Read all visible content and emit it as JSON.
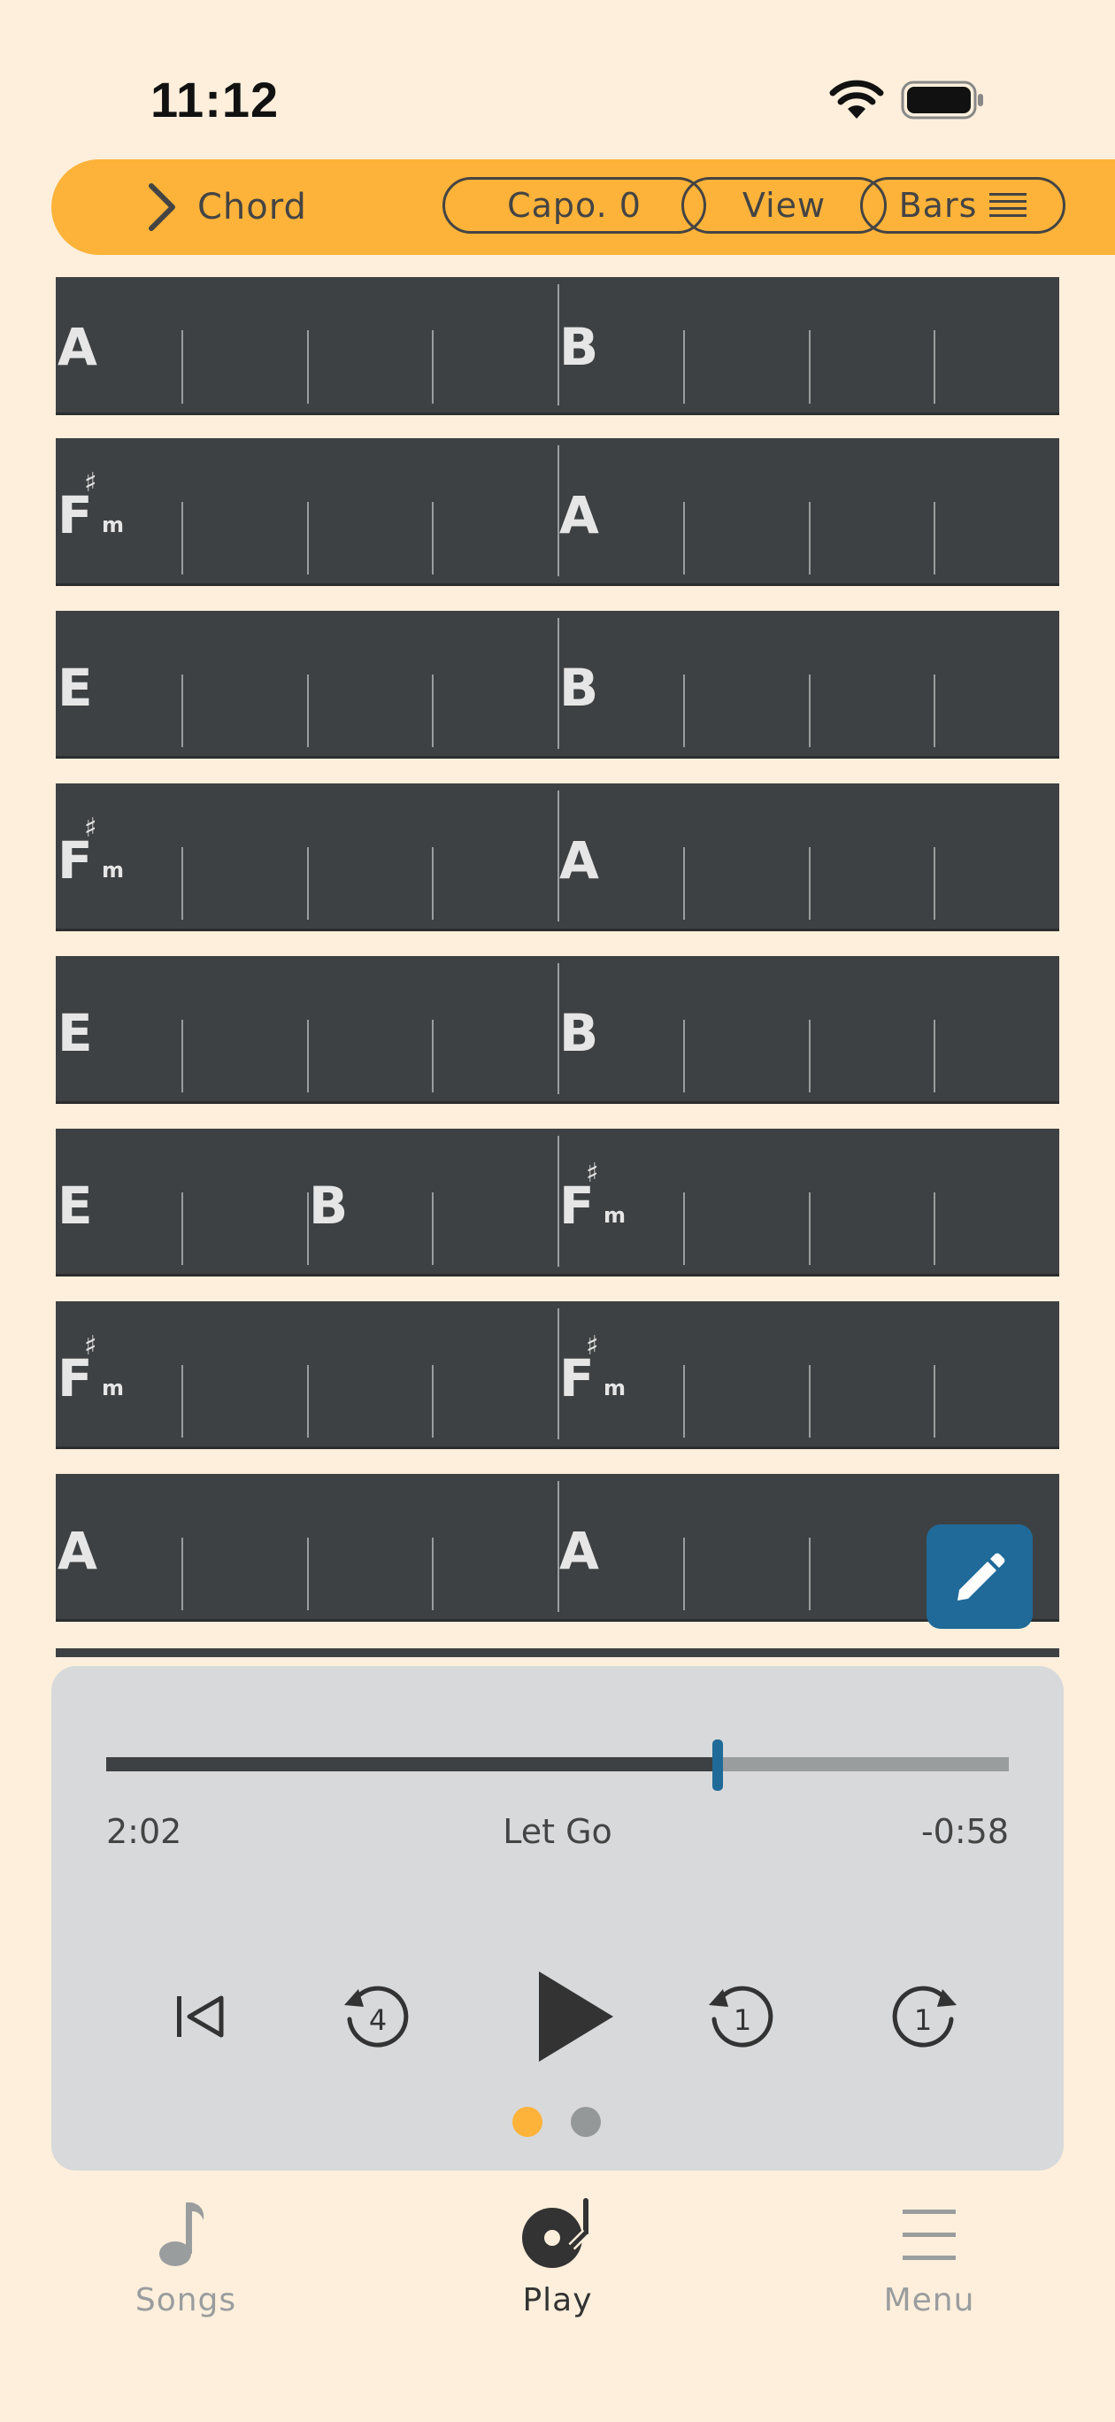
{
  "status_bar": {
    "time": "11:12",
    "wifi_icon": "wifi-icon",
    "battery_icon": "battery-icon"
  },
  "header": {
    "back_icon": "chevron-right-icon",
    "title": "Chord",
    "capo_label": "Capo. 0",
    "view_label": "View",
    "bars_label": "Bars",
    "bars_icon": "list-lines-icon",
    "accent_color": "#fdb339"
  },
  "chord_rows": [
    {
      "chords": [
        {
          "root": "A",
          "acc": "",
          "qual": "",
          "beat": 0
        },
        {
          "root": "B",
          "acc": "",
          "qual": "",
          "beat": 4
        }
      ]
    },
    {
      "chords": [
        {
          "root": "F",
          "acc": "♯",
          "qual": "m",
          "beat": 0
        },
        {
          "root": "A",
          "acc": "",
          "qual": "",
          "beat": 4
        }
      ]
    },
    {
      "chords": [
        {
          "root": "E",
          "acc": "",
          "qual": "",
          "beat": 0
        },
        {
          "root": "B",
          "acc": "",
          "qual": "",
          "beat": 4
        }
      ]
    },
    {
      "chords": [
        {
          "root": "F",
          "acc": "♯",
          "qual": "m",
          "beat": 0
        },
        {
          "root": "A",
          "acc": "",
          "qual": "",
          "beat": 4
        }
      ]
    },
    {
      "chords": [
        {
          "root": "E",
          "acc": "",
          "qual": "",
          "beat": 0
        },
        {
          "root": "B",
          "acc": "",
          "qual": "",
          "beat": 4
        }
      ]
    },
    {
      "chords": [
        {
          "root": "E",
          "acc": "",
          "qual": "",
          "beat": 0
        },
        {
          "root": "B",
          "acc": "",
          "qual": "",
          "beat": 2
        },
        {
          "root": "F",
          "acc": "♯",
          "qual": "m",
          "beat": 4
        }
      ]
    },
    {
      "chords": [
        {
          "root": "F",
          "acc": "♯",
          "qual": "m",
          "beat": 0
        },
        {
          "root": "F",
          "acc": "♯",
          "qual": "m",
          "beat": 4
        }
      ]
    },
    {
      "chords": [
        {
          "root": "A",
          "acc": "",
          "qual": "",
          "beat": 0
        },
        {
          "root": "A",
          "acc": "",
          "qual": "",
          "beat": 4
        }
      ]
    }
  ],
  "edit_button": {
    "icon": "pencil-icon",
    "color": "#1f6a98"
  },
  "player": {
    "elapsed": "2:02",
    "title": "Let Go",
    "remaining": "-0:58",
    "progress": 0.677,
    "controls": [
      {
        "name": "skip-to-start-button",
        "icon": "skip-back-icon",
        "label": ""
      },
      {
        "name": "rewind-4-button",
        "icon": "rewind-icon",
        "label": "4"
      },
      {
        "name": "play-button",
        "icon": "play-icon",
        "label": ""
      },
      {
        "name": "back-1-button",
        "icon": "rewind-icon",
        "label": "1"
      },
      {
        "name": "forward-1-button",
        "icon": "forward-icon",
        "label": "1"
      }
    ],
    "page_dots": [
      {
        "active": true
      },
      {
        "active": false
      }
    ]
  },
  "tab_bar": {
    "tabs": [
      {
        "label": "Songs",
        "icon": "music-note-icon",
        "active": false
      },
      {
        "label": "Play",
        "icon": "turntable-icon",
        "active": true
      },
      {
        "label": "Menu",
        "icon": "menu-icon",
        "active": false
      }
    ]
  }
}
